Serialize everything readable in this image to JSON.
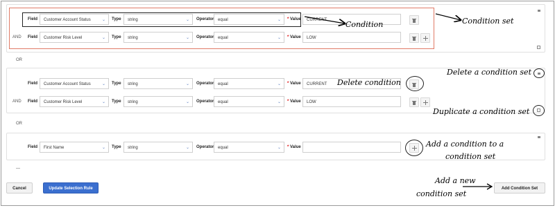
{
  "labels": {
    "field": "Field",
    "type": "Type",
    "operator": "Operator",
    "value": "Value",
    "required_mark": "*",
    "and": "AND",
    "or": "OR"
  },
  "sets": [
    {
      "rows": [
        {
          "field": "Customer Account Status",
          "type": "string",
          "operator": "equal",
          "value": "CURRENT"
        },
        {
          "field": "Customer Risk Level",
          "type": "string",
          "operator": "equal",
          "value": "LOW"
        }
      ]
    },
    {
      "rows": [
        {
          "field": "Customer Account Status",
          "type": "string",
          "operator": "equal",
          "value": "CURRENT"
        },
        {
          "field": "Customer Risk Level",
          "type": "string",
          "operator": "equal",
          "value": "LOW"
        }
      ]
    },
    {
      "rows": [
        {
          "field": "First Name",
          "type": "string",
          "operator": "equal",
          "value": ""
        }
      ]
    }
  ],
  "trailing_text": "—",
  "buttons": {
    "cancel": "Cancel",
    "update": "Update Selection Rule",
    "add_set": "Add Condition Set"
  },
  "annotations": {
    "condition": "Condition",
    "condition_set": "Condition set",
    "delete_condition_set": "Delete a condition set",
    "delete_condition": "Delete condition",
    "duplicate_condition_set": "Duplicate a condition set",
    "add_condition_line1": "Add a condition to a",
    "add_condition_line2": "condition set",
    "add_new_set_line1": "Add a new",
    "add_new_set_line2": "condition set"
  },
  "icons": [
    "trash-icon",
    "plus-icon",
    "copy-icon",
    "minimize-icon"
  ]
}
